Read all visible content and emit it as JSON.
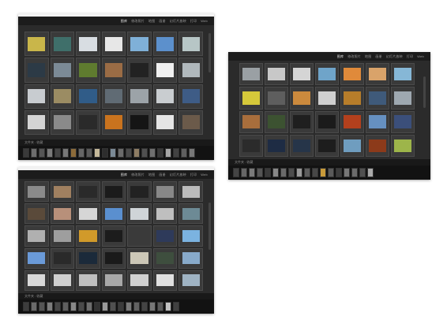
{
  "photos": [
    {
      "id": "top-left",
      "toolbar": [
        "图库",
        "修改照片",
        "地图",
        "画册",
        "幻灯片放映",
        "打印",
        "Web"
      ],
      "active_tab": "图库",
      "status_text": "文件夹 : 收藏",
      "grid": {
        "cols": 7,
        "rows": 4,
        "thumb_colors": [
          "#c9b64a",
          "#3f6f6a",
          "#d8dde2",
          "#e7e7e7",
          "#7fb0d8",
          "#5c90cc",
          "#b7c6c6",
          "#2c3a46",
          "#7b8a96",
          "#5f7b2f",
          "#9a6c45",
          "#222222",
          "#f0f0f0",
          "#b0b8bc",
          "#c8ccd0",
          "#9b8c63",
          "#305c88",
          "#606b74",
          "#9ca3a8",
          "#c9cdd0",
          "#3e5c86",
          "#d4d4d4",
          "#8a8a8a",
          "#2a2a2a",
          "#c9731e",
          "#151515",
          "#e5e5e5",
          "#6b5a4a"
        ]
      },
      "filmstrip_colors": [
        "#3a3a3a",
        "#6d6d6d",
        "#555",
        "#7a7a7a",
        "#444",
        "#777",
        "#8c6b3a",
        "#666",
        "#5a5a5a",
        "#c5b99a",
        "#2d2d2d",
        "#7b8a96",
        "#6b6b6b",
        "#4a4a4a",
        "#8e7d64",
        "#505050",
        "#6f6f6f",
        "#383838",
        "#a6a6a6",
        "#424242",
        "#5f5f5f",
        "#777"
      ]
    },
    {
      "id": "right",
      "toolbar": [
        "图库",
        "修改照片",
        "地图",
        "画册",
        "幻灯片放映",
        "打印",
        "Web"
      ],
      "active_tab": "图库",
      "status_text": "文件夹 : 收藏",
      "grid": {
        "cols": 7,
        "rows": 4,
        "thumb_colors": [
          "#9aa0a4",
          "#c8c8c8",
          "#d5d5d5",
          "#6fa4c9",
          "#e08a3a",
          "#d9a36a",
          "#86b7d6",
          "#d6c93a",
          "#5e5e5e",
          "#cc8a3d",
          "#cfcfcf",
          "#b77d2a",
          "#3f5a7a",
          "#9ea8b0",
          "#a86e3c",
          "#3c5231",
          "#1f1f1f",
          "#1b1b1b",
          "#b3401d",
          "#6690c0",
          "#3b4f7a",
          "#2b2b2b",
          "#1e2c44",
          "#263549",
          "#1d1d1d",
          "#6f9dbf",
          "#8c3a1a",
          "#9db54a"
        ]
      },
      "filmstrip_colors": [
        "#444",
        "#666",
        "#7a7a7a",
        "#555",
        "#3a3a3a",
        "#888",
        "#6a6a6a",
        "#4c4c4c",
        "#999",
        "#5c5c5c",
        "#474747",
        "#c89a3a",
        "#5a5a5a",
        "#3c3c3c",
        "#777",
        "#6b6b6b",
        "#505050",
        "#aaa"
      ]
    },
    {
      "id": "bottom-left",
      "toolbar": [
        "图库",
        "修改照片",
        "地图",
        "画册",
        "幻灯片放映",
        "打印",
        "Web"
      ],
      "active_tab": "图库",
      "status_text": "文件夹 : 收藏",
      "grid": {
        "cols": 7,
        "rows": 5,
        "thumb_colors": [
          "#8a8a8a",
          "#a08060",
          "#2a2a2a",
          "#1b1b1b",
          "#222222",
          "#888888",
          "#bbbbbb",
          "#5a4a3a",
          "#b8907a",
          "#d6d6d6",
          "#5a8fcf",
          "#cfd4d8",
          "#bfbfbf",
          "#6d8a95",
          "#b0b0b0",
          "#9e9e9e",
          "#d19a2a",
          "#1c1c1c",
          "#3a3a3a",
          "#2e3a5a",
          "#7bb3e0",
          "#6a9ad8",
          "#2a2a2a",
          "#1b2a3a",
          "#1a1a1a",
          "#ccc7b7",
          "#3e4e3e",
          "#88aaca",
          "#d8d8d8",
          "#cfcfcf",
          "#bfbfbf",
          "#a8a8a8",
          "#d0d0d0",
          "#e0e0e0",
          "#9fb3c3"
        ]
      },
      "filmstrip_colors": [
        "#3c3c3c",
        "#6a6a6a",
        "#555",
        "#7d7d7d",
        "#474747",
        "#5f5f5f",
        "#888",
        "#4a4a4a",
        "#6e6e6e",
        "#333",
        "#9a9a9a",
        "#505050",
        "#3b3b3b",
        "#7a7a7a",
        "#626262",
        "#444",
        "#777",
        "#5a5a5a",
        "#c2c2c2",
        "#404040"
      ]
    }
  ]
}
